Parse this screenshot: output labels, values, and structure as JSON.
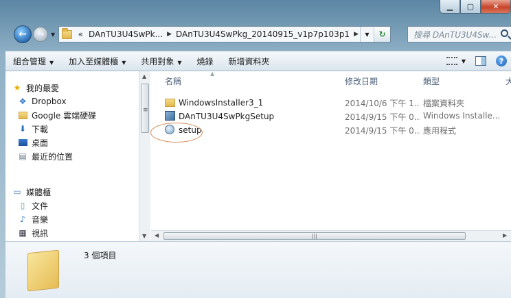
{
  "window": {
    "caption_buttons": [
      "minimize",
      "maximize",
      "close"
    ]
  },
  "address": {
    "overflow": "«",
    "crumbs": [
      "DAnTU3U4SwPk...",
      "DAnTU3U4SwPkg_20140915_v1p7p103p1"
    ],
    "search_placeholder": "搜尋 DAnTU3U4Sw..."
  },
  "toolbar": {
    "organize": "組合管理",
    "include_in_library": "加入至媒體櫃",
    "share_with": "共用對象",
    "burn": "燒錄",
    "new_folder": "新增資料夾",
    "help": "?"
  },
  "navigation": {
    "favorites_header": "我的最愛",
    "favorites": [
      "Dropbox",
      "Google 雲端硬碟",
      "下載",
      "桌面",
      "最近的位置"
    ],
    "libraries_header": "媒體櫃",
    "libraries": [
      "文件",
      "音樂",
      "視訊"
    ]
  },
  "columns": {
    "name": "名稱",
    "date_modified": "修改日期",
    "type": "類型",
    "size": "大"
  },
  "files": [
    {
      "name": "WindowsInstaller3_1",
      "date": "2014/10/6 下午 1...",
      "type": "檔案資料夾",
      "icon": "folder-icon"
    },
    {
      "name": "DAnTU3U4SwPkgSetup",
      "date": "2014/9/15 下午 0...",
      "type": "Windows Installe...",
      "icon": "msi-installer-icon"
    },
    {
      "name": "setup",
      "date": "2014/9/15 下午 0...",
      "type": "應用程式",
      "icon": "setup-app-icon"
    }
  ],
  "details": {
    "item_count": "3 個項目"
  },
  "colors": {
    "highlight_circle": "#d08a56",
    "header_text": "#4c607a"
  }
}
